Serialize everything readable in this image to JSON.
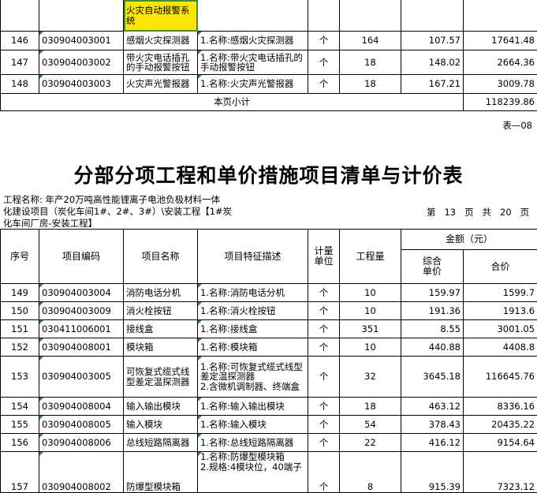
{
  "top_table": {
    "rows": [
      {
        "no": "",
        "code": "",
        "name": "火灾自动报警系统",
        "desc": "",
        "unit": "",
        "qty": "",
        "price": "",
        "total": ""
      },
      {
        "no": "146",
        "code": "030904003001",
        "name": "感烟火灾探测器",
        "desc": "1.名称:感烟火灾探测器",
        "unit": "个",
        "qty": "164",
        "price": "107.57",
        "total": "17641.48"
      },
      {
        "no": "147",
        "code": "030904003002",
        "name": "带火灾电话插孔的手动报警按钮",
        "desc": "1.名称:带火灾电话插孔的手动报警按钮",
        "unit": "个",
        "qty": "18",
        "price": "148.02",
        "total": "2664.36"
      },
      {
        "no": "148",
        "code": "030904003003",
        "name": "火灾声光警报器",
        "desc": "1.名称:火灾声光警报器",
        "unit": "个",
        "qty": "18",
        "price": "167.21",
        "total": "3009.78"
      }
    ],
    "subtotal_label": "本页小计",
    "subtotal_value": "118239.86"
  },
  "table_ref": "表—08",
  "title": "分部分项工程和单价措施项目清单与计价表",
  "project_line1": "工程名称: 年产20万吨高性能锂离子电池负极材料一体",
  "project_line2": "化建设项目（炭化车间1#、2#、3#）\\安装工程【1#炭",
  "project_line3": "化车间厂房-安装工程】",
  "page_info": "第   13   页   共   20   页",
  "headers": {
    "no": "序号",
    "code": "项目编码",
    "name": "项目名称",
    "desc": "项目特征描述",
    "unit": "计量单位",
    "qty": "工程量",
    "amount": "金额（元）",
    "unit_price": "综合单价",
    "total": "合价"
  },
  "rows": [
    {
      "no": "149",
      "code": "030904003004",
      "name": "消防电话分机",
      "desc": "1.名称:消防电话分机",
      "unit": "个",
      "qty": "10",
      "price": "159.97",
      "total": "1599.7"
    },
    {
      "no": "150",
      "code": "030904003009",
      "name": "消火栓按钮",
      "desc": "1.名称:消火栓按钮",
      "unit": "个",
      "qty": "10",
      "price": "191.36",
      "total": "1913.6"
    },
    {
      "no": "151",
      "code": "030411006001",
      "name": "接线盒",
      "desc": "1.名称:接线盒",
      "unit": "个",
      "qty": "351",
      "price": "8.55",
      "total": "3001.05"
    },
    {
      "no": "152",
      "code": "030904008001",
      "name": "模块箱",
      "desc": "1.名称:模块箱",
      "unit": "个",
      "qty": "10",
      "price": "440.88",
      "total": "4408.8"
    },
    {
      "no": "153",
      "code": "030904003005",
      "name": "可恢复式缆式线型差定温探测器",
      "desc": "1.名称:可恢复式缆式线型差定温探测器\n2.含微机调制器、终端盒",
      "unit": "个",
      "qty": "32",
      "price": "3645.18",
      "total": "116645.76"
    },
    {
      "no": "154",
      "code": "030904008004",
      "name": "输入输出模块",
      "desc": "1.名称:输入输出模块",
      "unit": "个",
      "qty": "18",
      "price": "463.12",
      "total": "8336.16"
    },
    {
      "no": "155",
      "code": "030904008005",
      "name": "输入模块",
      "desc": "1.名称:输入模块",
      "unit": "个",
      "qty": "54",
      "price": "378.43",
      "total": "20435.22"
    },
    {
      "no": "156",
      "code": "030904008006",
      "name": "总线短路隔离器",
      "desc": "1.名称:总线短路隔离器",
      "unit": "个",
      "qty": "22",
      "price": "416.12",
      "total": "9154.64"
    },
    {
      "no": "157",
      "code": "030904008002",
      "name": "防爆型模块箱",
      "desc": "1.名称:防爆型模块箱\n2.规格:4模块位，40端子",
      "unit": "个",
      "qty": "8",
      "price": "915.39",
      "total": "7323.12"
    }
  ]
}
